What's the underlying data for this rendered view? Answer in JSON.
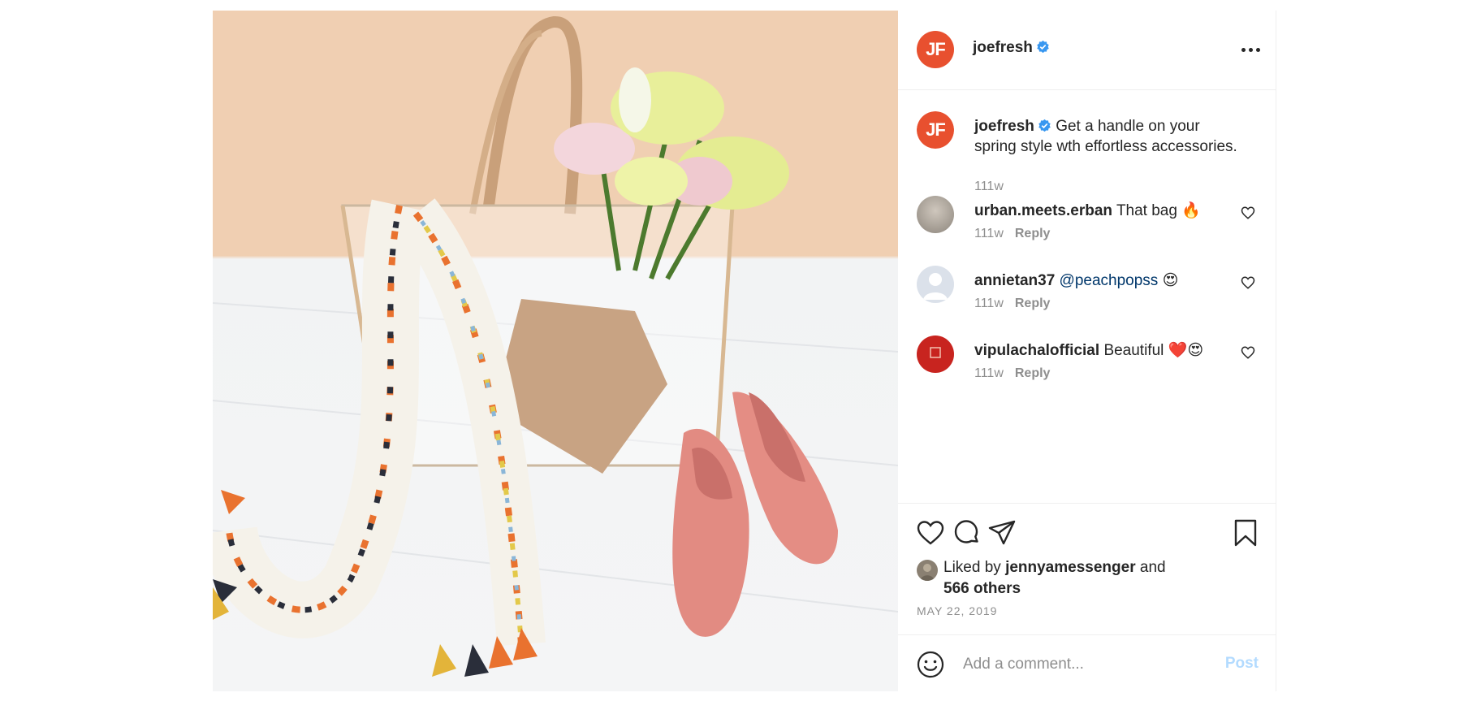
{
  "post": {
    "author": "joefresh",
    "author_initials": "JF",
    "caption": "Get a handle on your spring style wth effortless accessories.",
    "caption_age": "111w",
    "likes_prefix": "Liked by",
    "likes_user": "jennyamessenger",
    "likes_and": "and",
    "likes_others": "566 others",
    "date": "MAY 22, 2019"
  },
  "comments": [
    {
      "user": "urban.meets.erban",
      "text": "That bag 🔥",
      "mention": "",
      "age": "111w",
      "reply_label": "Reply"
    },
    {
      "user": "annietan37",
      "text": " 😍",
      "mention": "@peachpopss",
      "age": "111w",
      "reply_label": "Reply"
    },
    {
      "user": "vipulachalofficial",
      "text": "Beautiful ❤️😍",
      "mention": "",
      "age": "111w",
      "reply_label": "Reply"
    }
  ],
  "add_comment": {
    "placeholder": "Add a comment...",
    "post_label": "Post"
  },
  "colors": {
    "brand": "#e8502f",
    "verified": "#3897f0",
    "post_disabled": "#b3dbff",
    "muted": "#8e8e8e"
  },
  "icons": [
    "more-options-icon",
    "verified-badge-icon",
    "heart-icon",
    "comment-icon",
    "share-icon",
    "bookmark-icon",
    "emoji-icon"
  ],
  "image": {
    "description_hidden": true
  }
}
